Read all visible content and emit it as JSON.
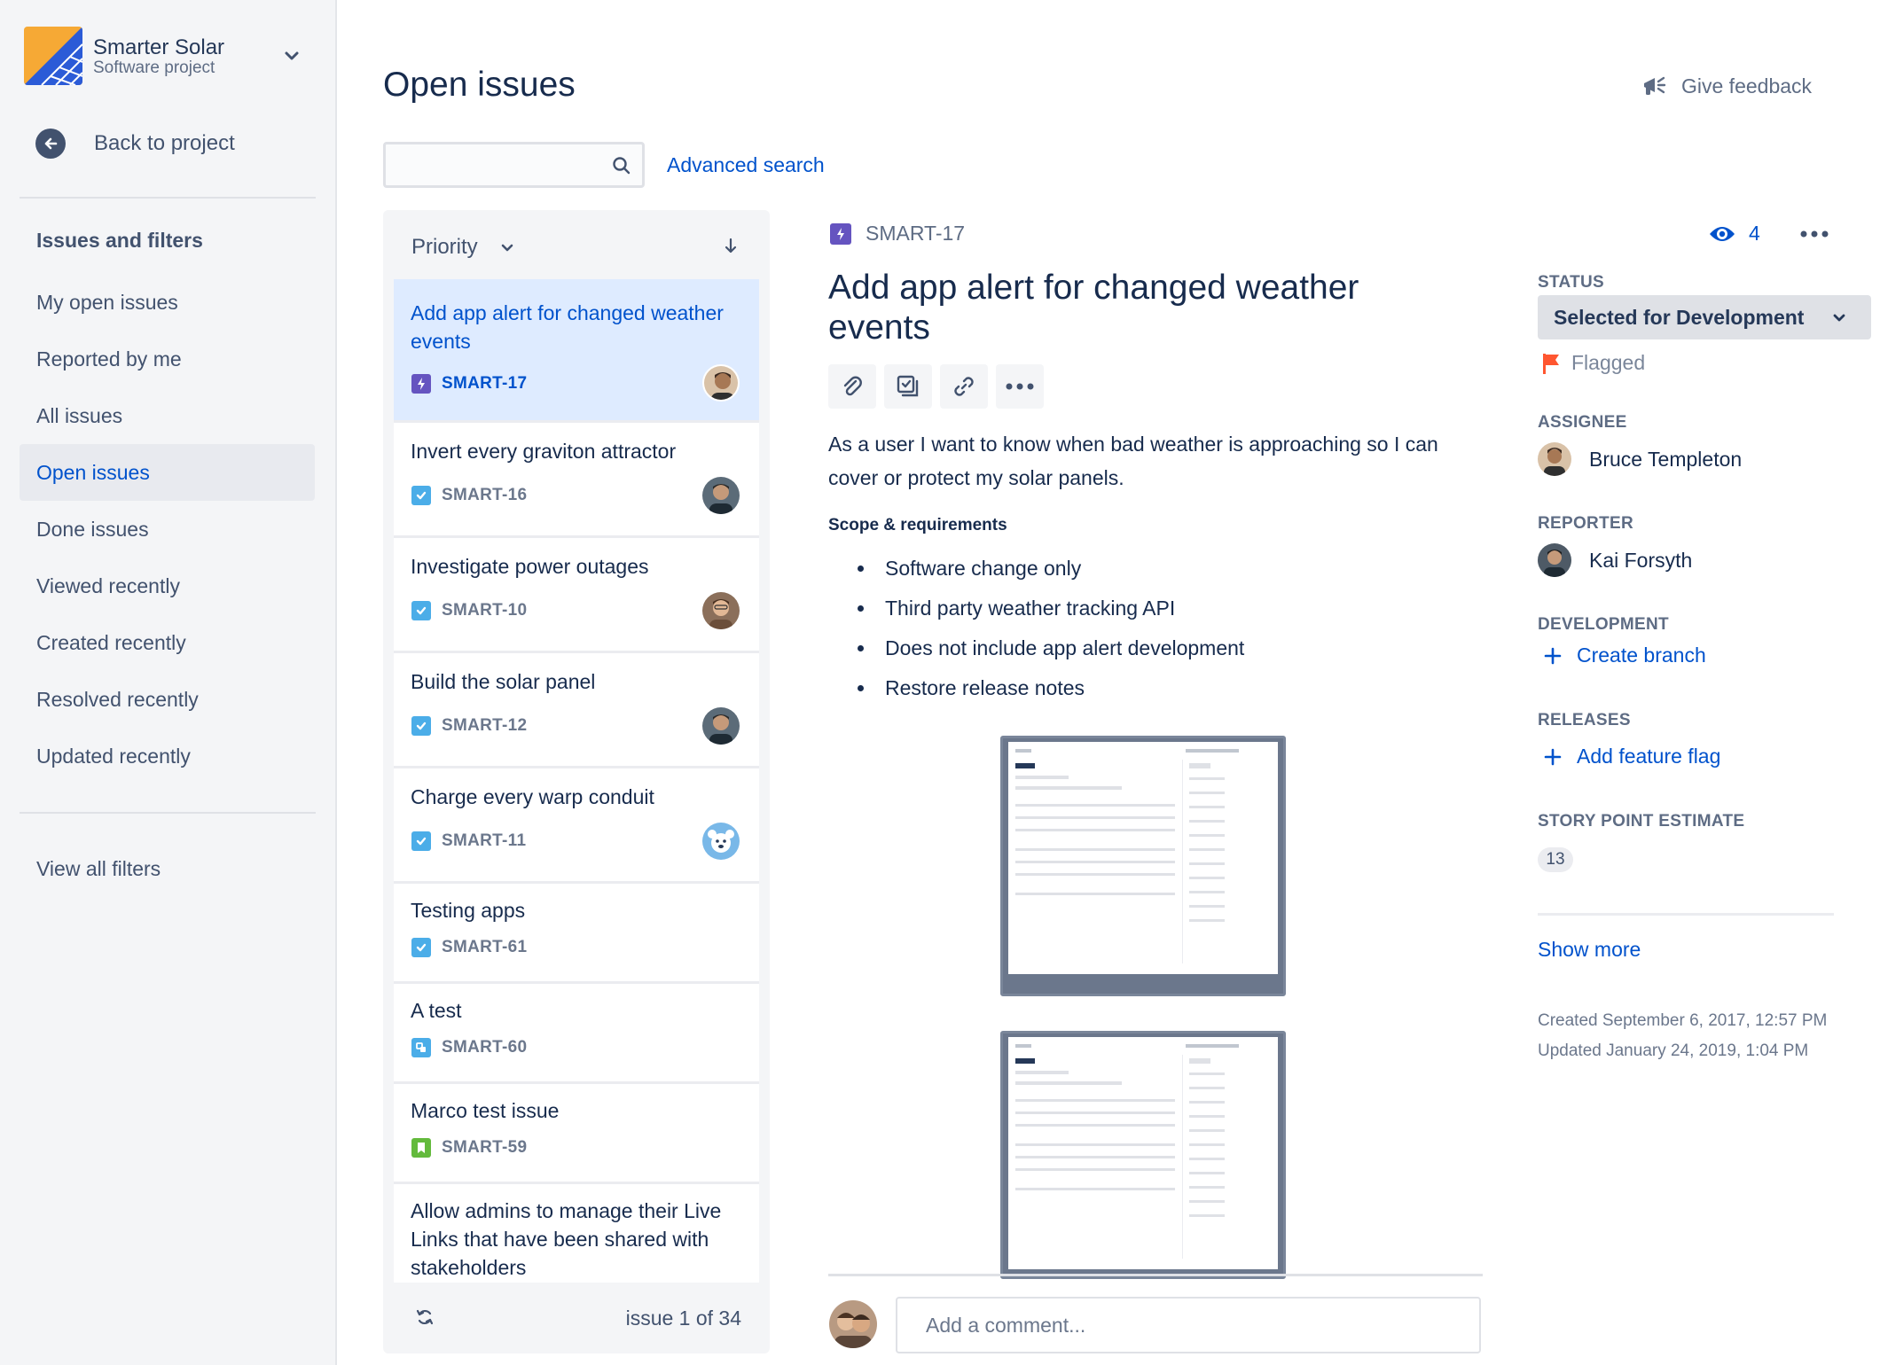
{
  "project": {
    "name": "Smarter Solar",
    "type": "Software project",
    "back_label": "Back to project"
  },
  "sidebar": {
    "section_title": "Issues and filters",
    "items": [
      {
        "label": "My open issues",
        "active": false
      },
      {
        "label": "Reported by me",
        "active": false
      },
      {
        "label": "All issues",
        "active": false
      },
      {
        "label": "Open issues",
        "active": true
      },
      {
        "label": "Done issues",
        "active": false
      },
      {
        "label": "Viewed recently",
        "active": false
      },
      {
        "label": "Created recently",
        "active": false
      },
      {
        "label": "Resolved recently",
        "active": false
      },
      {
        "label": "Updated recently",
        "active": false
      }
    ],
    "view_all": "View all filters"
  },
  "header": {
    "title": "Open issues",
    "feedback": "Give feedback"
  },
  "search": {
    "value": "",
    "placeholder": "",
    "advanced": "Advanced search"
  },
  "list": {
    "sort_label": "Priority",
    "issues": [
      {
        "title": "Add app alert for changed weather events",
        "key": "SMART-17",
        "type": "epic-icon",
        "selected": true
      },
      {
        "title": "Invert every graviton attractor",
        "key": "SMART-16",
        "type": "task-icon"
      },
      {
        "title": "Investigate power outages",
        "key": "SMART-10",
        "type": "task-icon"
      },
      {
        "title": "Build the solar panel",
        "key": "SMART-12",
        "type": "task-icon"
      },
      {
        "title": "Charge every warp conduit",
        "key": "SMART-11",
        "type": "task-icon"
      },
      {
        "title": "Testing apps",
        "key": "SMART-61",
        "type": "task-icon"
      },
      {
        "title": "A test",
        "key": "SMART-60",
        "type": "subtask-icon"
      },
      {
        "title": "Marco test issue",
        "key": "SMART-59",
        "type": "story-icon"
      },
      {
        "title": "Allow admins to manage their Live Links that have been shared with stakeholders",
        "key": "",
        "type": ""
      }
    ],
    "pager": "issue 1 of 34"
  },
  "issue": {
    "key": "SMART-17",
    "watchers": "4",
    "title": "Add app alert for changed weather events",
    "description": "As a user I want to know when bad weather is approaching so I can cover or protect my solar panels.",
    "scope_heading": "Scope & requirements",
    "bullets": [
      "Software change only",
      "Third party weather tracking API",
      "Does not include app alert development",
      "Restore release notes"
    ],
    "comment_placeholder": "Add a comment..."
  },
  "fields": {
    "status_label": "STATUS",
    "status_value": "Selected for Development",
    "flagged": "Flagged",
    "assignee_label": "ASSIGNEE",
    "assignee": "Bruce Templeton",
    "reporter_label": "REPORTER",
    "reporter": "Kai Forsyth",
    "development_label": "DEVELOPMENT",
    "create_branch": "Create branch",
    "releases_label": "RELEASES",
    "add_flag": "Add feature flag",
    "story_points_label": "STORY POINT ESTIMATE",
    "story_points": "13",
    "show_more": "Show more",
    "created": "Created September 6, 2017, 12:57 PM",
    "updated": "Updated January 24, 2019, 1:04 PM"
  },
  "colors": {
    "link": "#0052CC",
    "text": "#172B4D",
    "sidebar_bg": "#F4F5F7",
    "selected_card": "#DEEBFF",
    "epic": "#6554C0",
    "task": "#4BADE8",
    "story": "#63BA3C",
    "flag": "#FF5630"
  }
}
